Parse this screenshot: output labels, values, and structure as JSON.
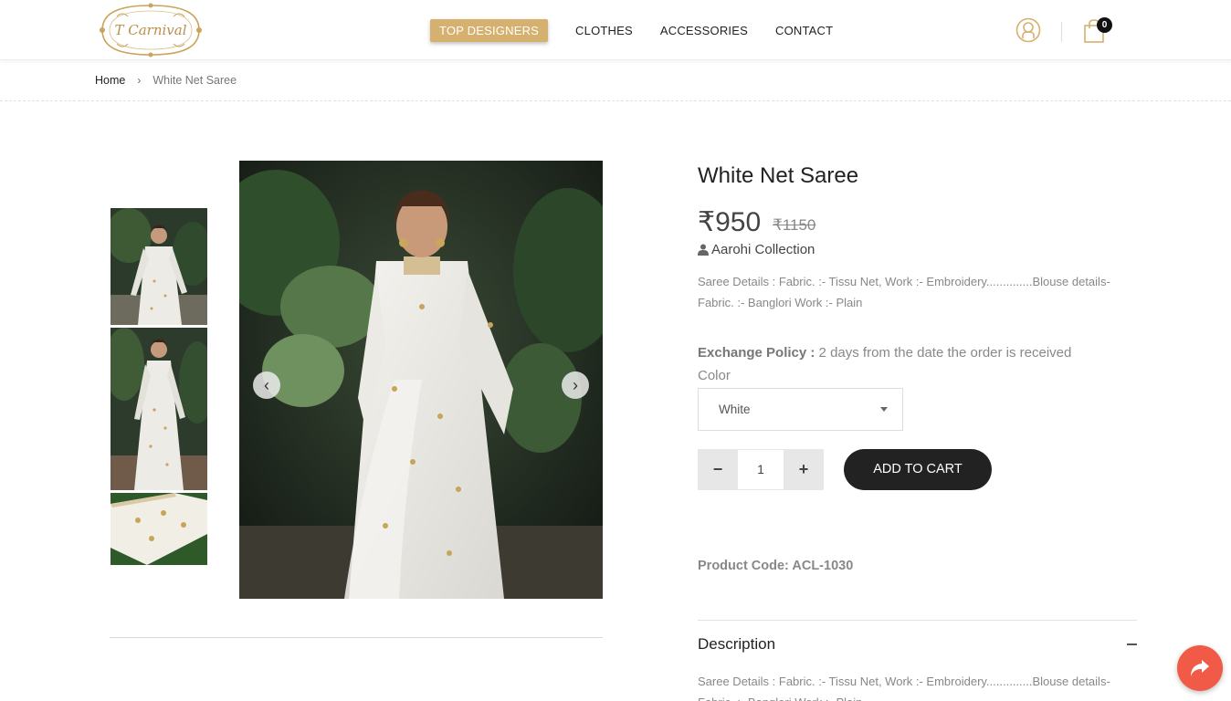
{
  "header": {
    "logo_text": "T Carnival",
    "nav": [
      {
        "label": "TOP DESIGNERS",
        "active": true
      },
      {
        "label": "CLOTHES",
        "active": false
      },
      {
        "label": "ACCESSORIES",
        "active": false
      },
      {
        "label": "CONTACT",
        "active": false
      }
    ],
    "cart_count": "0",
    "accent_color": "#d5b06f"
  },
  "breadcrumb": {
    "home": "Home",
    "separator": "›",
    "current": "White Net Saree"
  },
  "gallery": {
    "prev_arrow": "‹",
    "next_arrow": "›",
    "thumbnails": [
      "thumbnail-1",
      "thumbnail-2",
      "thumbnail-3"
    ]
  },
  "product": {
    "title": "White Net Saree",
    "price": "₹950",
    "old_price": "₹1150",
    "brand": "Aarohi Collection",
    "details": "Saree Details : Fabric. :- Tissu Net, Work :- Embroidery..............Blouse details- Fabric. :- Banglori Work :- Plain",
    "exchange_label": "Exchange Policy :",
    "exchange_value": " 2 days from the date the order is received",
    "color_label": "Color",
    "color_selected": "White",
    "qty_minus": "−",
    "qty_value": "1",
    "qty_plus": "+",
    "add_to_cart": "ADD TO CART",
    "product_code": "Product Code: ACL-1030"
  },
  "description": {
    "title": "Description",
    "toggle": "−",
    "text": "Saree Details : Fabric. :- Tissu Net, Work :- Embroidery..............Blouse details- Fabric. :- Banglori Work :- Plain"
  },
  "share": {
    "icon": "share-icon",
    "color": "#f05a47"
  }
}
